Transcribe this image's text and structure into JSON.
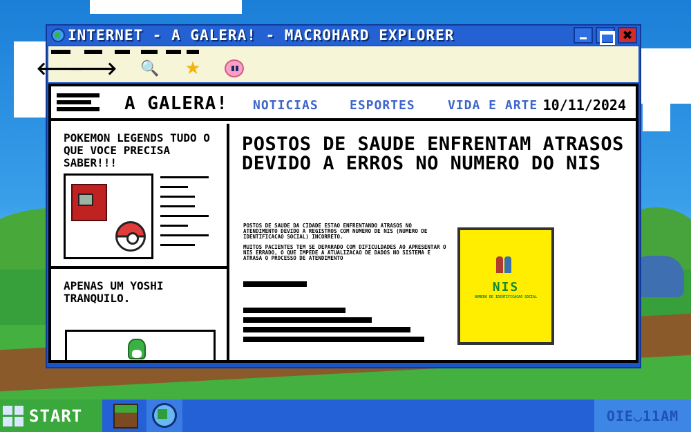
{
  "window": {
    "title": "INTERNET - A GALERA! - MACROHARD EXPLORER",
    "close_glyph": "✖"
  },
  "toolbar": {
    "back_glyph": "🡐",
    "forward_glyph": "🡒",
    "search_glyph": "🔍",
    "favorites_glyph": "★"
  },
  "site": {
    "name": "A GALERA!",
    "nav": [
      "NOTICIAS",
      "ESPORTES",
      "VIDA E ARTE"
    ],
    "date": "10/11/2024"
  },
  "sidebar": {
    "card1_title": "POKEMON LEGENDS TUDO O QUE VOCE PRECISA SABER!!!",
    "card2_title": "APENAS UM YOSHI TRANQUILO."
  },
  "article": {
    "headline": "POSTOS DE SAUDE ENFRENTAM ATRASOS DEVIDO A ERROS NO NUMERO DO NIS",
    "paragraph1": "POSTOS DE SAUDE DA CIDADE ESTAO ENFRENTANDO ATRASOS NO ATENDIMENTO DEVIDO A REGISTROS COM NUMERO DE NIS (NUMERO DE IDENTIFICACAO SOCIAL) INCORRETO.",
    "paragraph2": "MUITOS PACIENTES TEM SE DEPARADO COM DIFICULDADES AO APRESENTAR O NIS ERRADO, O QUE IMPEDE A ATUALIZACAO DE DADOS NO SISTEMA E ATRASA O PROCESSO DE ATENDIMENTO",
    "nis_logo": "NIS",
    "nis_subtitle": "NUMERO DE IDENTIFICACAO SOCIAL",
    "nis_card_color": "#ffee00"
  },
  "taskbar": {
    "start_label": "START",
    "clock": "OIE◡11AM"
  },
  "colors": {
    "titlebar": "#2462d4",
    "toolbar_bg": "#f7f5d8",
    "nav_link": "#3d66c9",
    "start_button": "#3aa83c",
    "taskbar": "#2461d6"
  }
}
